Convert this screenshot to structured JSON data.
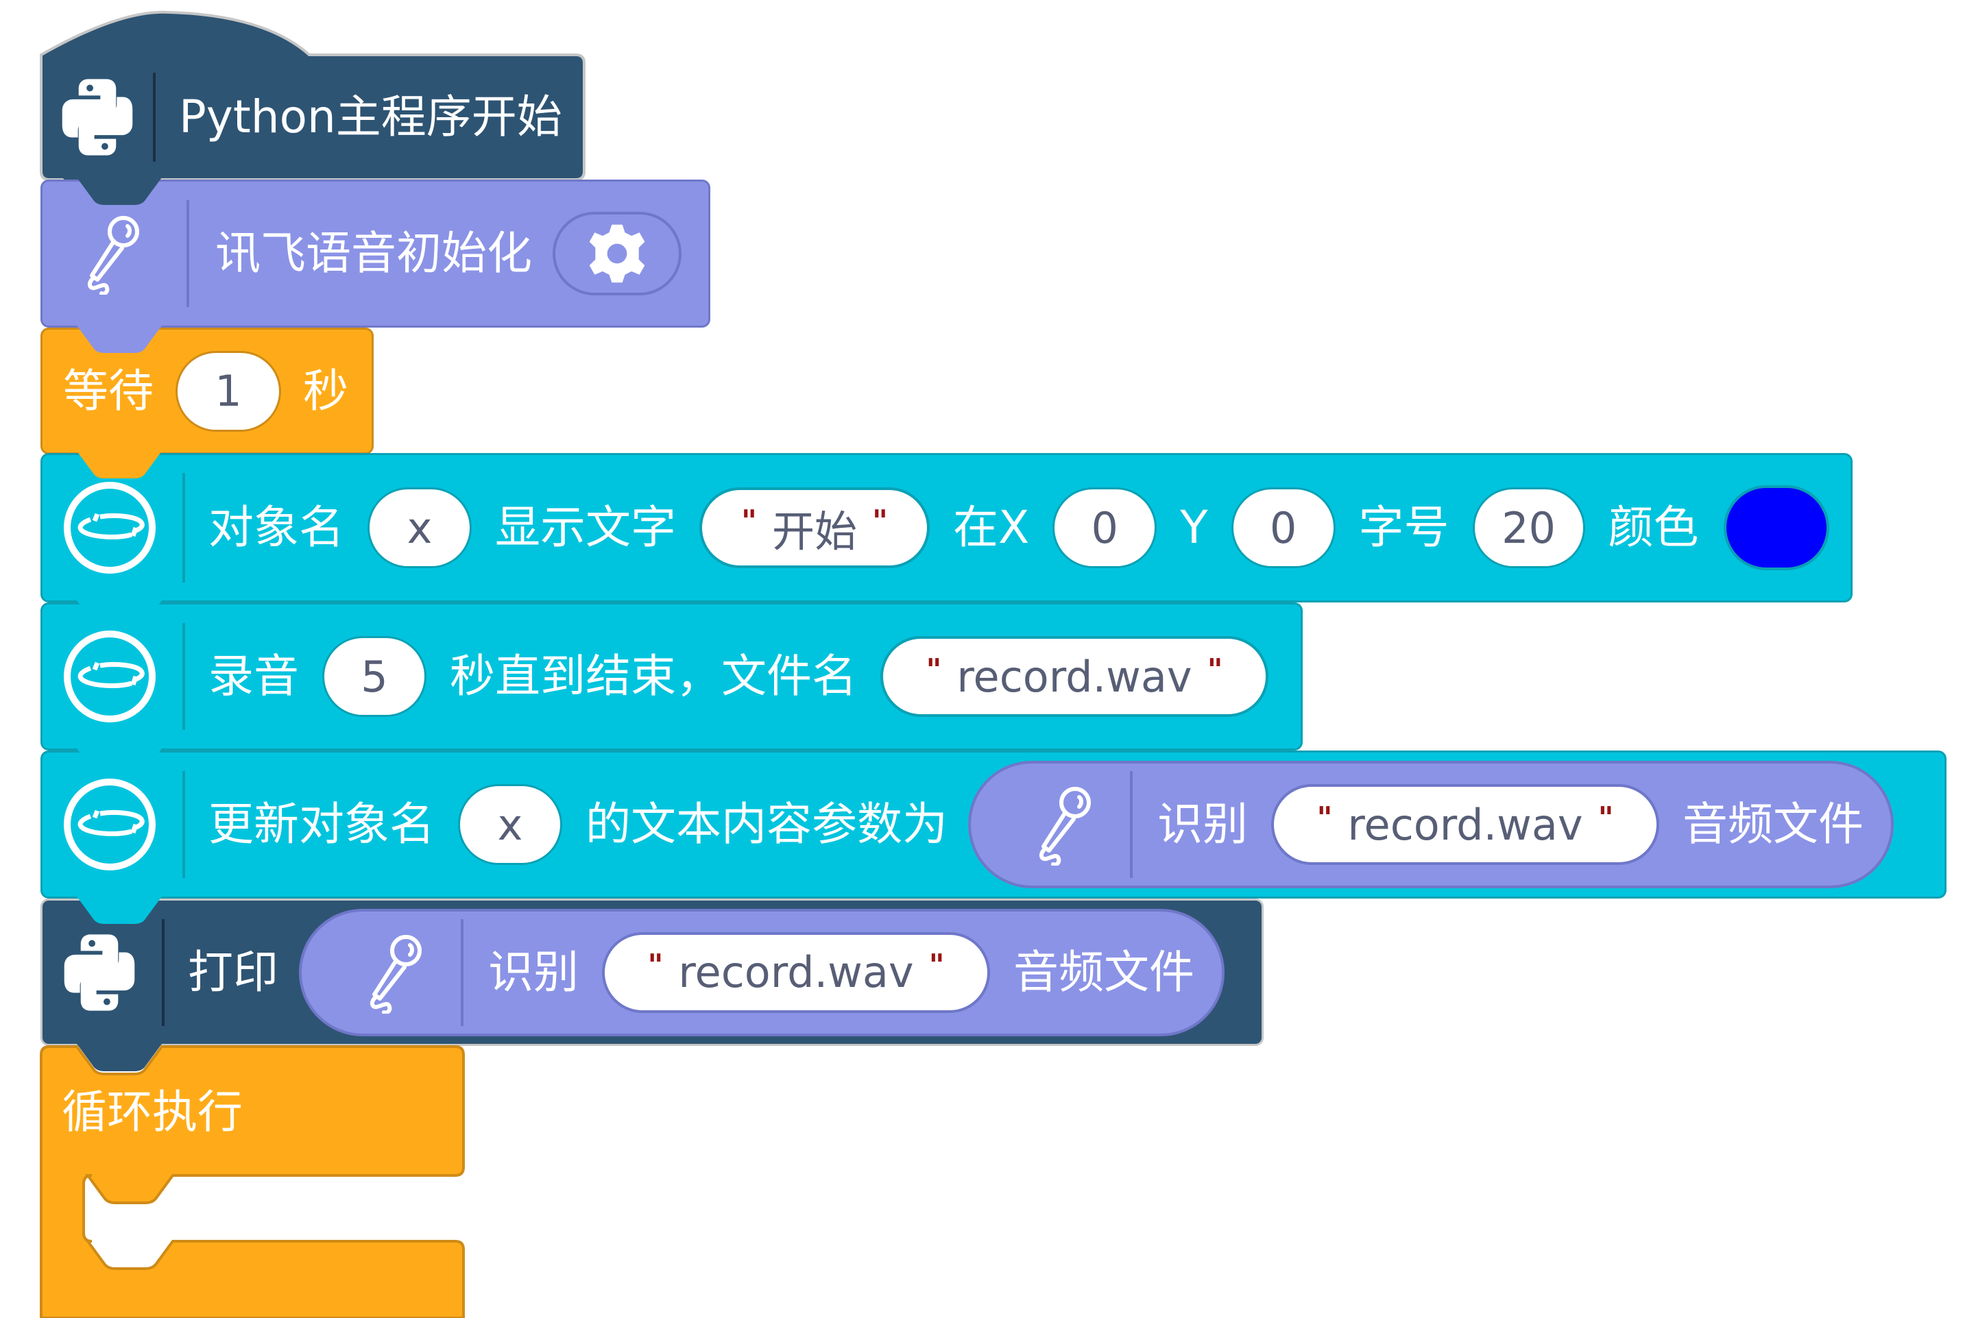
{
  "blocks": {
    "main_start": {
      "label": "Python主程序开始",
      "icon": "python-icon",
      "color": "#2e5473"
    },
    "xunfei_init": {
      "label": "讯飞语音初始化",
      "icon": "microphone-icon",
      "settings_icon": "gear-icon",
      "color": "#8b93e6"
    },
    "wait": {
      "prefix": "等待",
      "value": "1",
      "suffix": "秒",
      "color": "#ffab19"
    },
    "show_text": {
      "icon": "loop-icon",
      "label_object": "对象名",
      "object": "x",
      "label_text": "显示文字",
      "text": "开始",
      "label_x": "在X",
      "x": "0",
      "label_y": "Y",
      "y": "0",
      "label_size": "字号",
      "size": "20",
      "label_color": "颜色",
      "color_value": "#0000ff",
      "color": "#00c4de"
    },
    "record": {
      "icon": "loop-icon",
      "prefix": "录音",
      "seconds": "5",
      "middle": "秒直到结束，文件名",
      "filename": "record.wav"
    },
    "update_text": {
      "icon": "loop-icon",
      "prefix": "更新对象名",
      "object": "x",
      "middle": "的文本内容参数为",
      "reporter": {
        "icon": "microphone-icon",
        "prefix": "识别",
        "filename": "record.wav",
        "suffix": "音频文件"
      }
    },
    "print": {
      "icon": "python-icon",
      "label": "打印",
      "reporter": {
        "icon": "microphone-icon",
        "prefix": "识别",
        "filename": "record.wav",
        "suffix": "音频文件"
      }
    },
    "forever": {
      "label": "循环执行"
    }
  },
  "quote_mark": "\""
}
